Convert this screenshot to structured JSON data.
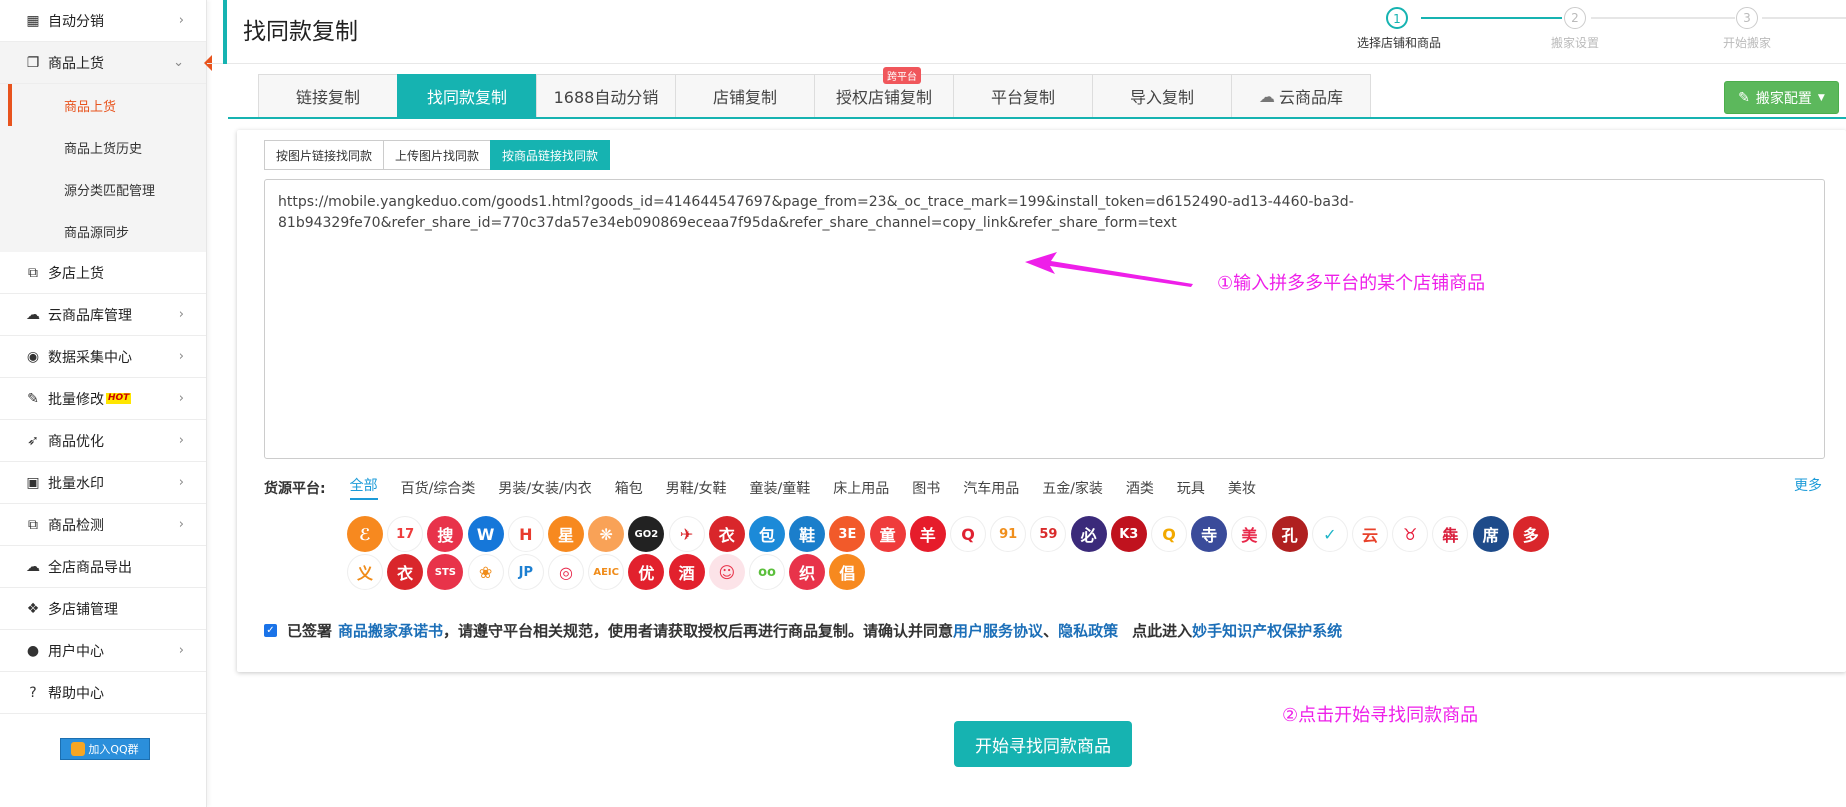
{
  "colors": {
    "accent": "#16b3b1",
    "sidebar_active": "#e8531d",
    "annotation": "#ee1fe9",
    "link": "#1c6fb8",
    "success": "#5cb85c"
  },
  "sidebar": {
    "items": [
      {
        "label": "自动分销",
        "icon": "calendar-icon",
        "glyph": "▦",
        "chevron": "›"
      },
      {
        "label": "商品上货",
        "icon": "copy-icon",
        "glyph": "❐",
        "chevron": "⌄"
      },
      {
        "label": "多店上货",
        "icon": "clone-icon",
        "glyph": "⧉"
      },
      {
        "label": "云商品库管理",
        "icon": "cloud-icon",
        "glyph": "☁",
        "chevron": "›"
      },
      {
        "label": "数据采集中心",
        "icon": "database-icon",
        "glyph": "◉",
        "chevron": "›"
      },
      {
        "label": "批量修改",
        "icon": "edit-icon",
        "glyph": "✎",
        "chevron": "›",
        "badge": "HOT"
      },
      {
        "label": "商品优化",
        "icon": "rocket-icon",
        "glyph": "➶",
        "chevron": "›"
      },
      {
        "label": "批量水印",
        "icon": "image-icon",
        "glyph": "▣",
        "chevron": "›"
      },
      {
        "label": "商品检测",
        "icon": "clone-icon",
        "glyph": "⧉",
        "chevron": "›"
      },
      {
        "label": "全店商品导出",
        "icon": "cloud-download-icon",
        "glyph": "☁"
      },
      {
        "label": "多店铺管理",
        "icon": "cubes-icon",
        "glyph": "❖"
      },
      {
        "label": "用户中心",
        "icon": "user-icon",
        "glyph": "●",
        "chevron": "›"
      },
      {
        "label": "帮助中心",
        "icon": "question-icon",
        "glyph": "?"
      }
    ],
    "sub_items": [
      "商品上货",
      "商品上货历史",
      "源分类匹配管理",
      "商品源同步"
    ],
    "qq_button": "加入QQ群"
  },
  "header": {
    "title": "找同款复制",
    "steps": [
      {
        "num": "1",
        "label": "选择店铺和商品",
        "active": true
      },
      {
        "num": "2",
        "label": "搬家设置",
        "active": false
      },
      {
        "num": "3",
        "label": "开始搬家",
        "active": false
      }
    ]
  },
  "tabs": [
    {
      "label": "链接复制"
    },
    {
      "label": "找同款复制",
      "active": true
    },
    {
      "label": "1688自动分销"
    },
    {
      "label": "店铺复制"
    },
    {
      "label": "授权店铺复制",
      "badge": "跨平台"
    },
    {
      "label": "平台复制"
    },
    {
      "label": "导入复制"
    },
    {
      "label": "云商品库",
      "icon": "cloud-icon"
    }
  ],
  "config_button": "搬家配置",
  "subtabs": [
    {
      "label": "按图片链接找同款"
    },
    {
      "label": "上传图片找同款"
    },
    {
      "label": "按商品链接找同款",
      "active": true
    }
  ],
  "url_input": "https://mobile.yangkeduo.com/goods1.html?goods_id=414644547697&page_from=23&_oc_trace_mark=199&install_token=d6152490-ad13-4460-ba3d-\n81b94329fe70&refer_share_id=770c37da57e34eb090869eceaa7f95da&refer_share_channel=copy_link&refer_share_form=text",
  "annotations": {
    "step1": "①输入拼多多平台的某个店铺商品",
    "step2": "②点击开始寻找同款商品"
  },
  "platform": {
    "label": "货源平台:",
    "categories": [
      "全部",
      "百货/综合类",
      "男装/女装/内衣",
      "箱包",
      "男鞋/女鞋",
      "童装/童鞋",
      "床上用品",
      "图书",
      "汽车用品",
      "五金/家装",
      "酒类",
      "玩具",
      "美妆"
    ],
    "more": "更多",
    "icons": [
      {
        "g": "ℰ",
        "c": "#f7891f"
      },
      {
        "g": "17",
        "c": "#fff",
        "fg": "#ee3c3c"
      },
      {
        "g": "搜",
        "c": "#e8334a"
      },
      {
        "g": "W",
        "c": "#1677d9"
      },
      {
        "g": "H",
        "c": "#fff",
        "fg": "#e83a2d"
      },
      {
        "g": "星",
        "c": "#f7891f"
      },
      {
        "g": "❋",
        "c": "#f9a257"
      },
      {
        "g": "GO2",
        "c": "#222"
      },
      {
        "g": "✈",
        "c": "#fff",
        "fg": "#d9262b"
      },
      {
        "g": "衣",
        "c": "#d9262b"
      },
      {
        "g": "包",
        "c": "#1c8ad8"
      },
      {
        "g": "鞋",
        "c": "#1b7ecb"
      },
      {
        "g": "3E",
        "c": "#f25a2a"
      },
      {
        "g": "童",
        "c": "#ef3b3b"
      },
      {
        "g": "羊",
        "c": "#e61c2b"
      },
      {
        "g": "Q",
        "c": "#fff",
        "fg": "#e02232"
      },
      {
        "g": "91",
        "c": "#fff",
        "fg": "#f08f1c"
      },
      {
        "g": "59",
        "c": "#fff",
        "fg": "#d92b2b"
      },
      {
        "g": "必",
        "c": "#3b2a7a"
      },
      {
        "g": "K3",
        "c": "#c0121e"
      },
      {
        "g": "Q",
        "c": "#fff",
        "fg": "#f2a900"
      },
      {
        "g": "寺",
        "c": "#3a4b9a"
      },
      {
        "g": "美",
        "c": "#fff",
        "fg": "#e8284a"
      },
      {
        "g": "孔",
        "c": "#b02020"
      },
      {
        "g": "✓",
        "c": "#fff",
        "fg": "#1fb5c8"
      },
      {
        "g": "云",
        "c": "#fff",
        "fg": "#e8422b"
      },
      {
        "g": "♉",
        "c": "#fff",
        "fg": "#e81c3b"
      },
      {
        "g": "犇",
        "c": "#fff",
        "fg": "#d91f3c"
      },
      {
        "g": "席",
        "c": "#1e4b8a"
      },
      {
        "g": "多",
        "c": "#d9262b"
      },
      {
        "g": "义",
        "c": "#fff",
        "fg": "#f08c1a"
      },
      {
        "g": "衣",
        "c": "#d9262b"
      },
      {
        "g": "STS",
        "c": "#e8334a"
      },
      {
        "g": "❀",
        "c": "#fff",
        "fg": "#f08c1a"
      },
      {
        "g": "JP",
        "c": "#fff",
        "fg": "#1c7fd1"
      },
      {
        "g": "◎",
        "c": "#fff",
        "fg": "#e8284a"
      },
      {
        "g": "AEIC",
        "c": "#fff",
        "fg": "#f08c1a"
      },
      {
        "g": "优",
        "c": "#e2212d"
      },
      {
        "g": "酒",
        "c": "#e2212d"
      },
      {
        "g": "☺",
        "c": "#fce3e8",
        "fg": "#e8334a"
      },
      {
        "g": "oo",
        "c": "#fff",
        "fg": "#5bbf3c"
      },
      {
        "g": "织",
        "c": "#e8334a"
      },
      {
        "g": "倡",
        "c": "#f7891f"
      }
    ]
  },
  "agreement": {
    "prefix": "已签署",
    "link1": "商品搬家承诺书",
    "mid": "，请遵守平台相关规范，使用者请获取授权后再进行商品复制。请确认并同意",
    "link2": "用户服务协议",
    "sep": "、",
    "link3": "隐私政策",
    "mid2": "点此进入",
    "link4": "妙手知识产权保护系统"
  },
  "start_button": "开始寻找同款商品"
}
